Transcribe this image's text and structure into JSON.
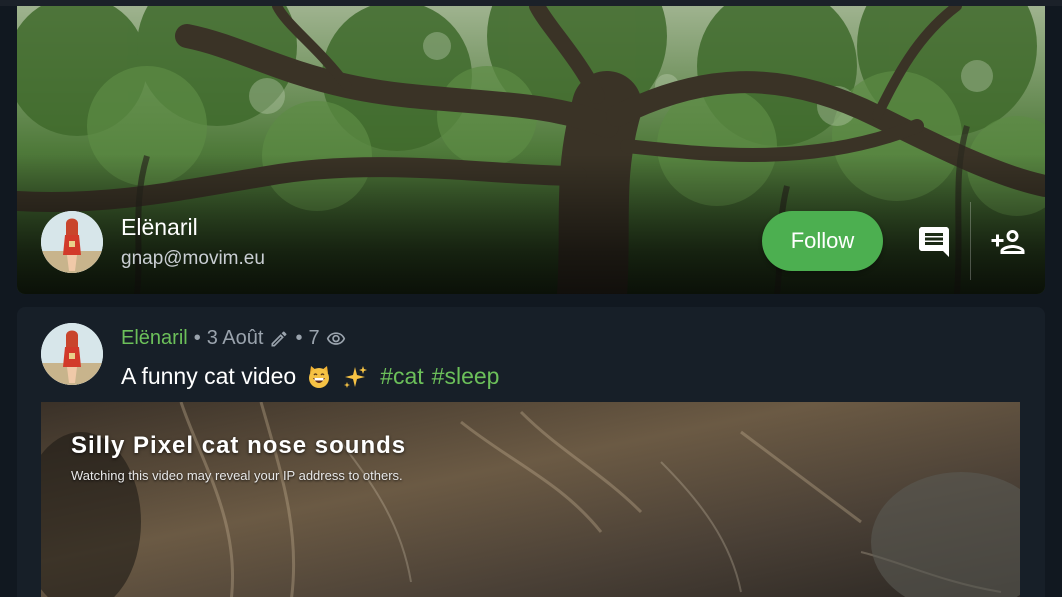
{
  "profile": {
    "name": "Elënaril",
    "handle": "gnap@movim.eu",
    "follow_label": "Follow",
    "chat_icon": "chat-icon",
    "add_contact_icon": "person-add-icon"
  },
  "post": {
    "author": "Elënaril",
    "separator": "•",
    "date": "3 Août",
    "views": "7",
    "title": "A funny cat video",
    "emojis": [
      "grinning-cat-emoji",
      "sparkles-emoji"
    ],
    "tags": [
      "#cat",
      "#sleep"
    ],
    "video": {
      "title": "Silly Pixel cat nose sounds",
      "warning": "Watching this video may reveal your IP address to others."
    }
  },
  "colors": {
    "accent_green": "#4caf50",
    "link_green": "#6cc05a",
    "background": "#111820",
    "card": "#171f28"
  }
}
